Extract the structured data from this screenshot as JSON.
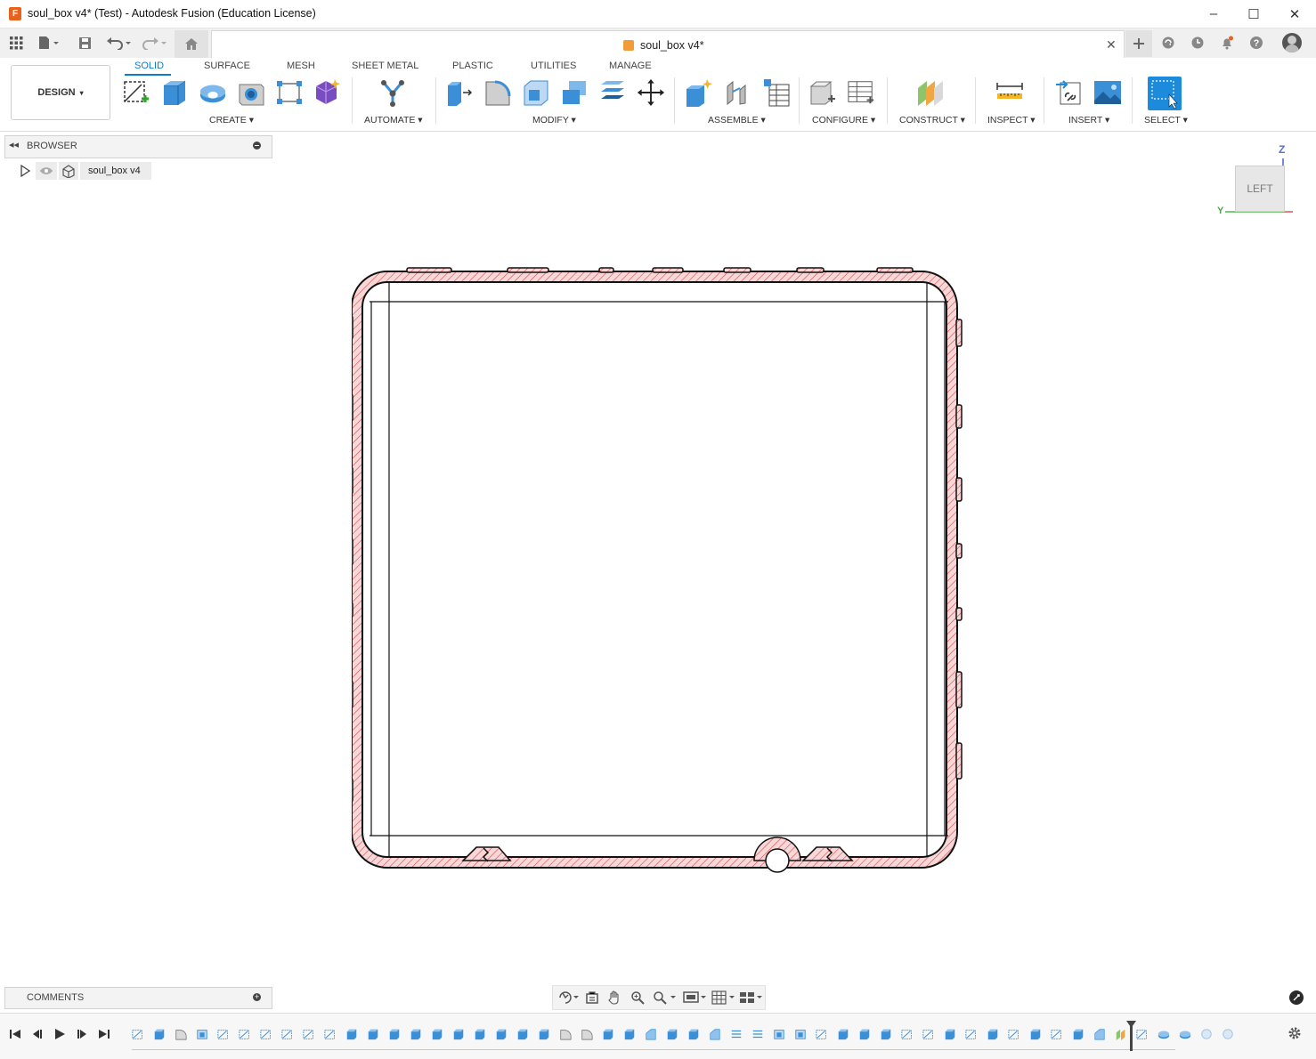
{
  "window": {
    "title": "soul_box v4* (Test) - Autodesk Fusion (Education License)",
    "app_icon_letter": "F",
    "minimize_icon": "–",
    "maximize_icon": "☐",
    "close_icon": "✕"
  },
  "doc_tab": {
    "title": "soul_box v4*",
    "close_icon": "✕"
  },
  "workspace": {
    "label": "DESIGN",
    "caret": "▾"
  },
  "ribbon_tabs": [
    {
      "label": "SOLID",
      "active": true
    },
    {
      "label": "SURFACE",
      "active": false
    },
    {
      "label": "MESH",
      "active": false
    },
    {
      "label": "SHEET METAL",
      "active": false
    },
    {
      "label": "PLASTIC",
      "active": false
    },
    {
      "label": "UTILITIES",
      "active": false
    },
    {
      "label": "MANAGE",
      "active": false
    }
  ],
  "ribbon_groups": {
    "create": "CREATE ▾",
    "automate": "AUTOMATE ▾",
    "modify": "MODIFY ▾",
    "assemble": "ASSEMBLE ▾",
    "configure": "CONFIGURE ▾",
    "construct": "CONSTRUCT ▾",
    "inspect": "INSPECT ▾",
    "insert": "INSERT ▾",
    "select": "SELECT ▾"
  },
  "browser": {
    "title": "BROWSER",
    "collapse_icon": "◂◂",
    "root_item": "soul_box v4"
  },
  "viewcube": {
    "face": "LEFT",
    "axis_z": "Z",
    "axis_y": "Y"
  },
  "comments": {
    "title": "COMMENTS",
    "add_icon": "+"
  },
  "colors": {
    "accent": "#0d7bd1",
    "section_fill": "#f7d7d7",
    "hatch": "#d84a4a",
    "timeline_feature": "#3a8fd6"
  },
  "timeline": {
    "controls": [
      "⏮",
      "◀",
      "▶",
      "▶",
      "⏭"
    ]
  }
}
